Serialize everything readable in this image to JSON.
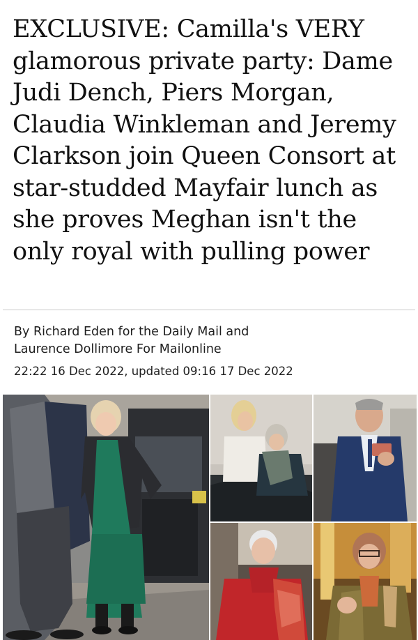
{
  "article": {
    "headline": "EXCLUSIVE: Camilla's VERY glamorous private party: Dame Judi Dench, Piers Morgan, Claudia Winkleman and Jeremy Clarkson join Queen Consort at star-studded Mayfair lunch as she proves Meghan isn't the only royal with pulling power",
    "byline": {
      "prefix": "By ",
      "author_1": "Richard Eden",
      "middle": " for the Daily Mail and ",
      "author_2": "Laurence Dollimore",
      "suffix": " For Mailonline"
    },
    "dateline": "22:22 16 Dec 2022, updated 09:16 17 Dec 2022"
  },
  "photos": [
    {
      "icon": "photo-camilla-green-dress"
    },
    {
      "icon": "photo-blonde-woman-and-older-woman"
    },
    {
      "icon": "photo-man-in-blue-suit-on-phone"
    },
    {
      "icon": "photo-judi-dench-red-coat"
    },
    {
      "icon": "photo-woman-with-glasses-patterned-coat"
    }
  ]
}
